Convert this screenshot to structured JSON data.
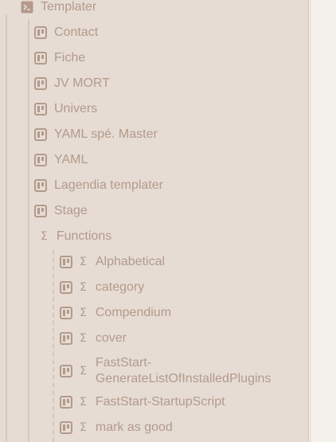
{
  "colors": {
    "panel": "#e6dcd3",
    "text": "#b39a8c",
    "icon": "#b39a8c"
  },
  "root": {
    "label": "Templater",
    "icon": "terminal-icon"
  },
  "templates": [
    {
      "label": "Contact",
      "icon": "kanban-icon"
    },
    {
      "label": "Fiche",
      "icon": "kanban-icon"
    },
    {
      "label": "JV MORT",
      "icon": "kanban-icon"
    },
    {
      "label": "Univers",
      "icon": "kanban-icon"
    },
    {
      "label": "YAML spé. Master",
      "icon": "kanban-icon"
    },
    {
      "label": "YAML",
      "icon": "kanban-icon"
    },
    {
      "label": "Lagendia templater",
      "icon": "kanban-icon"
    },
    {
      "label": "Stage",
      "icon": "kanban-icon"
    }
  ],
  "functions_folder": {
    "label": "Functions",
    "icon": "sigma-icon"
  },
  "functions": [
    {
      "label": "Alphabetical",
      "icon": "kanban-icon"
    },
    {
      "label": "category",
      "icon": "kanban-icon"
    },
    {
      "label": "Compendium",
      "icon": "kanban-icon"
    },
    {
      "label": "cover",
      "icon": "kanban-icon"
    },
    {
      "label": "FastStart-GenerateListOfInstalledPlugins",
      "icon": "kanban-icon"
    },
    {
      "label": "FastStart-StartupScript",
      "icon": "kanban-icon"
    },
    {
      "label": "mark as good",
      "icon": "kanban-icon"
    }
  ]
}
